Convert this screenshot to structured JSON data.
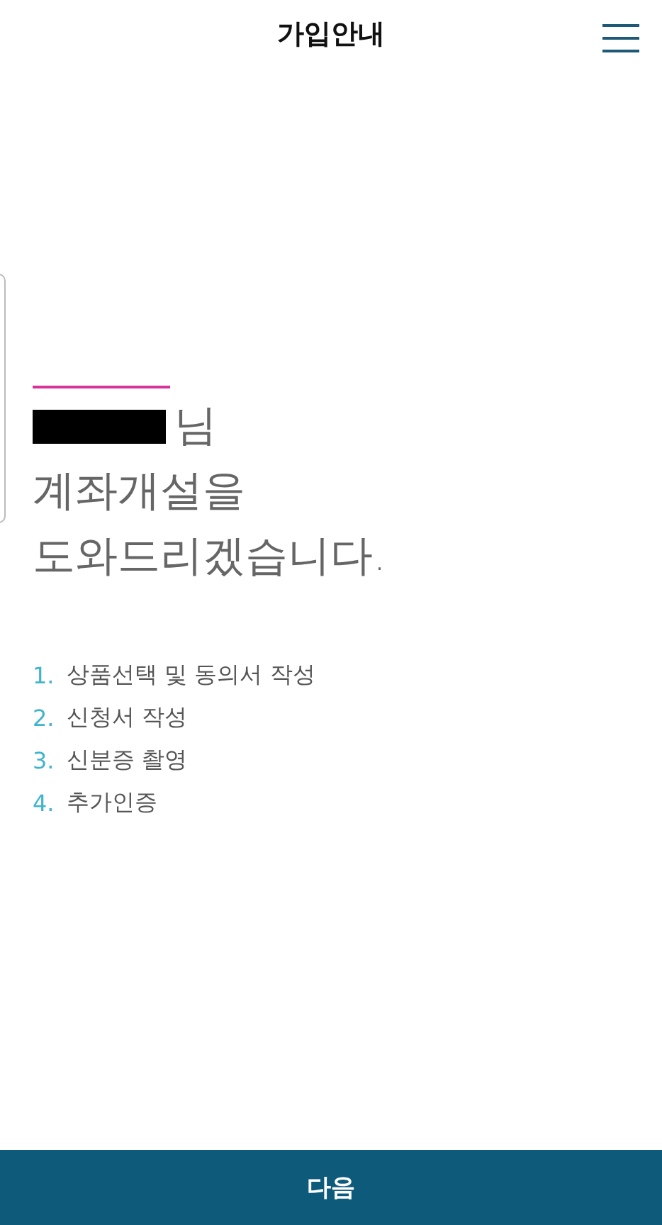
{
  "header": {
    "title": "가입안내"
  },
  "greeting": {
    "suffix": "님",
    "lines": [
      "계좌개설을",
      "도와드리겠습니다."
    ]
  },
  "steps": [
    {
      "number": "1.",
      "label": "상품선택 및 동의서 작성"
    },
    {
      "number": "2.",
      "label": "신청서 작성"
    },
    {
      "number": "3.",
      "label": "신분증 촬영"
    },
    {
      "number": "4.",
      "label": "추가인증"
    }
  ],
  "footer": {
    "button": "다음"
  }
}
